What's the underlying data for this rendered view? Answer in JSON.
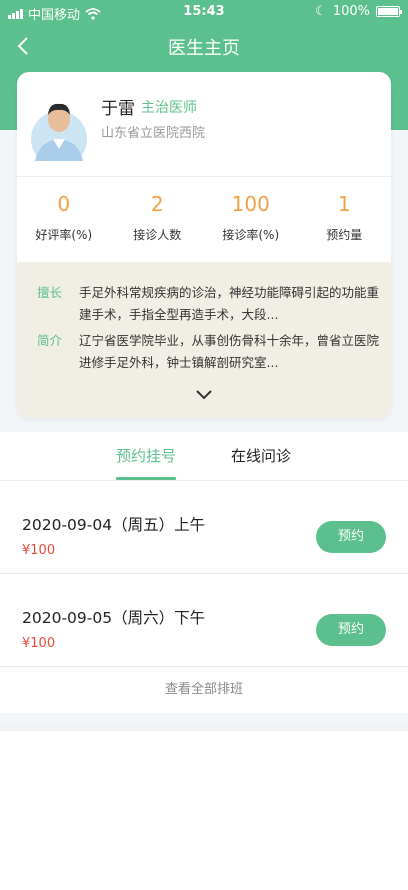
{
  "status_bar": {
    "carrier": "中国移动",
    "time": "15:43",
    "battery": "100%"
  },
  "nav": {
    "title": "医生主页"
  },
  "doctor": {
    "name": "于雷",
    "title": "主治医师",
    "hospital": "山东省立医院西院"
  },
  "stats": [
    {
      "value": "0",
      "label": "好评率(%)"
    },
    {
      "value": "2",
      "label": "接诊人数"
    },
    {
      "value": "100",
      "label": "接诊率(%)"
    },
    {
      "value": "1",
      "label": "预约量"
    }
  ],
  "intro": {
    "specialty_label": "擅长",
    "specialty_text": "手足外科常规疾病的诊治，神经功能障碍引起的功能重建手术，手指全型再造手术，大段...",
    "bio_label": "简介",
    "bio_text": "辽宁省医学院毕业，从事创伤骨科十余年，曾省立医院进修手足外科，钟士镇解剖研究室..."
  },
  "tabs": [
    {
      "label": "预约挂号",
      "active": true
    },
    {
      "label": "在线问诊",
      "active": false
    }
  ],
  "slots": [
    {
      "date": "2020-09-04（周五）上午",
      "price": "¥100",
      "button": "预约"
    },
    {
      "date": "2020-09-05（周六）下午",
      "price": "¥100",
      "button": "预约"
    }
  ],
  "view_all": "查看全部排班",
  "colors": {
    "primary": "#5cc08e",
    "accent_number": "#f0a147",
    "price": "#e64b3c",
    "intro_bg": "#f1eee5"
  }
}
